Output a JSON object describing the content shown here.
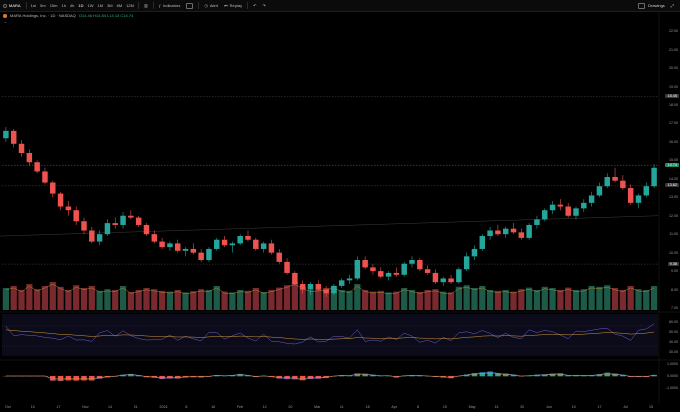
{
  "toolbar": {
    "symbol": "MARA",
    "timeframes": [
      "1m",
      "5m",
      "15m",
      "1h",
      "4h",
      "1D",
      "1W",
      "1M",
      "3M",
      "6M",
      "12M"
    ],
    "selected_timeframe": "1D",
    "indicators_label": "Indicators",
    "alert_label": "Alert",
    "replay_label": "Replay",
    "drawings_label": "Drawings",
    "undo_icon": "undo-icon",
    "redo_icon": "redo-icon"
  },
  "legend": {
    "title": "MARA Holdings, Inc. · 1D · NASDAQ",
    "ohlc": "O14.46 H14.84 L14.13 C14.74"
  },
  "price_axis": {
    "ticks": [
      "22.00",
      "21.00",
      "20.00",
      "19.00",
      "18.00",
      "17.00",
      "16.00",
      "15.00",
      "14.00",
      "13.00",
      "12.00",
      "11.00",
      "10.00",
      "9.00",
      "8.00",
      "7.00"
    ]
  },
  "price_tags": [
    {
      "label": "18.45",
      "color": "#3a3a3a"
    },
    {
      "label": "14.74",
      "color": "#1f8a6a"
    },
    {
      "label": "13.62",
      "color": "#3a3a3a"
    },
    {
      "label": "9.38",
      "color": "#3a3a3a"
    }
  ],
  "osc_axis": {
    "ticks": [
      "60.00",
      "50.00",
      "40.00",
      "30.00"
    ]
  },
  "macd_axis": {
    "ticks": [
      "1.0000",
      "0.0000",
      "-1.0000"
    ]
  },
  "time_axis": {
    "ticks": [
      "Oct",
      "10",
      "17",
      "Nov",
      "14",
      "21",
      "2024",
      "8",
      "16",
      "Feb",
      "12",
      "20",
      "Mar",
      "11",
      "18",
      "Apr",
      "8",
      "15",
      "May",
      "13",
      "20",
      "Jun",
      "10",
      "17",
      "Jul",
      "15"
    ]
  },
  "chart_data": {
    "type": "candlestick",
    "price_range": [
      7,
      22.5
    ],
    "candles": [
      [
        16.2,
        16.8,
        16.0,
        16.6
      ],
      [
        16.6,
        16.7,
        15.7,
        15.9
      ],
      [
        15.9,
        16.1,
        15.2,
        15.4
      ],
      [
        15.4,
        15.6,
        14.7,
        14.9
      ],
      [
        14.9,
        15.0,
        14.3,
        14.4
      ],
      [
        14.4,
        14.6,
        13.7,
        13.8
      ],
      [
        13.8,
        13.9,
        13.0,
        13.2
      ],
      [
        13.2,
        13.3,
        12.3,
        12.5
      ],
      [
        12.5,
        12.8,
        12.0,
        12.3
      ],
      [
        12.3,
        12.5,
        11.5,
        11.7
      ],
      [
        11.7,
        11.9,
        11.0,
        11.2
      ],
      [
        11.2,
        11.4,
        10.5,
        10.6
      ],
      [
        10.6,
        11.2,
        10.4,
        11.0
      ],
      [
        11.0,
        11.8,
        10.9,
        11.6
      ],
      [
        11.6,
        11.9,
        11.3,
        11.5
      ],
      [
        11.5,
        12.2,
        11.3,
        12.0
      ],
      [
        12.0,
        12.3,
        11.8,
        11.9
      ],
      [
        11.9,
        12.0,
        11.4,
        11.5
      ],
      [
        11.5,
        11.6,
        10.9,
        11.0
      ],
      [
        11.0,
        11.2,
        10.5,
        10.6
      ],
      [
        10.6,
        10.8,
        10.2,
        10.3
      ],
      [
        10.3,
        10.6,
        10.1,
        10.5
      ],
      [
        10.5,
        10.7,
        10.0,
        10.1
      ],
      [
        10.1,
        10.3,
        9.8,
        10.2
      ],
      [
        10.2,
        10.5,
        9.9,
        10.0
      ],
      [
        10.0,
        10.2,
        9.5,
        9.6
      ],
      [
        9.6,
        10.3,
        9.5,
        10.2
      ],
      [
        10.2,
        10.8,
        10.1,
        10.7
      ],
      [
        10.7,
        10.9,
        10.3,
        10.4
      ],
      [
        10.4,
        10.6,
        10.0,
        10.5
      ],
      [
        10.5,
        11.0,
        10.4,
        10.9
      ],
      [
        10.9,
        11.2,
        10.6,
        10.7
      ],
      [
        10.7,
        10.8,
        10.1,
        10.2
      ],
      [
        10.2,
        10.6,
        10.0,
        10.5
      ],
      [
        10.5,
        10.7,
        9.9,
        10.0
      ],
      [
        10.0,
        10.2,
        9.4,
        9.5
      ],
      [
        9.5,
        9.7,
        8.8,
        8.9
      ],
      [
        8.9,
        9.0,
        8.2,
        8.3
      ],
      [
        8.3,
        8.5,
        7.8,
        8.0
      ],
      [
        8.0,
        8.4,
        7.7,
        8.3
      ],
      [
        8.3,
        8.5,
        7.9,
        8.0
      ],
      [
        8.0,
        8.2,
        7.6,
        7.8
      ],
      [
        7.8,
        8.3,
        7.7,
        8.2
      ],
      [
        8.2,
        8.6,
        8.1,
        8.5
      ],
      [
        8.5,
        8.8,
        8.3,
        8.6
      ],
      [
        8.6,
        9.8,
        8.5,
        9.6
      ],
      [
        9.6,
        9.8,
        9.1,
        9.2
      ],
      [
        9.2,
        9.4,
        8.8,
        9.0
      ],
      [
        9.0,
        9.2,
        8.6,
        8.7
      ],
      [
        8.7,
        9.0,
        8.5,
        8.9
      ],
      [
        8.9,
        9.2,
        8.7,
        8.8
      ],
      [
        8.8,
        9.5,
        8.7,
        9.4
      ],
      [
        9.4,
        9.8,
        9.2,
        9.6
      ],
      [
        9.6,
        9.7,
        9.0,
        9.1
      ],
      [
        9.1,
        9.3,
        8.8,
        8.9
      ],
      [
        8.9,
        9.1,
        8.3,
        8.4
      ],
      [
        8.4,
        8.7,
        8.2,
        8.6
      ],
      [
        8.6,
        8.8,
        8.3,
        8.4
      ],
      [
        8.4,
        9.2,
        8.3,
        9.1
      ],
      [
        9.1,
        10.0,
        9.0,
        9.8
      ],
      [
        9.8,
        10.4,
        9.6,
        10.2
      ],
      [
        10.2,
        11.0,
        10.1,
        10.9
      ],
      [
        10.9,
        11.4,
        10.7,
        11.2
      ],
      [
        11.2,
        11.5,
        10.9,
        11.0
      ],
      [
        11.0,
        11.4,
        10.8,
        11.3
      ],
      [
        11.3,
        11.6,
        11.0,
        11.1
      ],
      [
        11.1,
        11.3,
        10.7,
        10.8
      ],
      [
        10.8,
        11.6,
        10.7,
        11.5
      ],
      [
        11.5,
        12.0,
        11.3,
        11.8
      ],
      [
        11.8,
        12.4,
        11.7,
        12.3
      ],
      [
        12.3,
        12.8,
        12.1,
        12.6
      ],
      [
        12.6,
        12.9,
        12.3,
        12.5
      ],
      [
        12.5,
        12.7,
        11.9,
        12.0
      ],
      [
        12.0,
        12.5,
        11.8,
        12.4
      ],
      [
        12.4,
        12.9,
        12.2,
        12.7
      ],
      [
        12.7,
        13.3,
        12.5,
        13.1
      ],
      [
        13.1,
        13.8,
        13.0,
        13.6
      ],
      [
        13.6,
        14.3,
        13.5,
        14.1
      ],
      [
        14.1,
        14.6,
        13.8,
        13.9
      ],
      [
        13.9,
        14.2,
        13.4,
        13.5
      ],
      [
        13.5,
        13.7,
        12.6,
        12.7
      ],
      [
        12.7,
        13.2,
        12.4,
        13.1
      ],
      [
        13.1,
        13.8,
        13.0,
        13.6
      ],
      [
        13.6,
        14.8,
        13.5,
        14.6
      ]
    ],
    "volume": [
      0.55,
      0.6,
      0.5,
      0.65,
      0.52,
      0.6,
      0.7,
      0.58,
      0.5,
      0.62,
      0.55,
      0.6,
      0.48,
      0.52,
      0.5,
      0.6,
      0.45,
      0.5,
      0.55,
      0.52,
      0.48,
      0.46,
      0.5,
      0.44,
      0.47,
      0.52,
      0.5,
      0.6,
      0.46,
      0.44,
      0.5,
      0.48,
      0.55,
      0.45,
      0.5,
      0.56,
      0.62,
      0.7,
      0.58,
      0.5,
      0.52,
      0.55,
      0.6,
      0.5,
      0.48,
      0.65,
      0.5,
      0.46,
      0.48,
      0.44,
      0.46,
      0.55,
      0.5,
      0.45,
      0.5,
      0.52,
      0.46,
      0.44,
      0.58,
      0.62,
      0.55,
      0.6,
      0.5,
      0.48,
      0.5,
      0.46,
      0.52,
      0.56,
      0.5,
      0.58,
      0.55,
      0.5,
      0.56,
      0.5,
      0.52,
      0.6,
      0.58,
      0.62,
      0.55,
      0.5,
      0.6,
      0.52,
      0.5,
      0.6
    ]
  }
}
